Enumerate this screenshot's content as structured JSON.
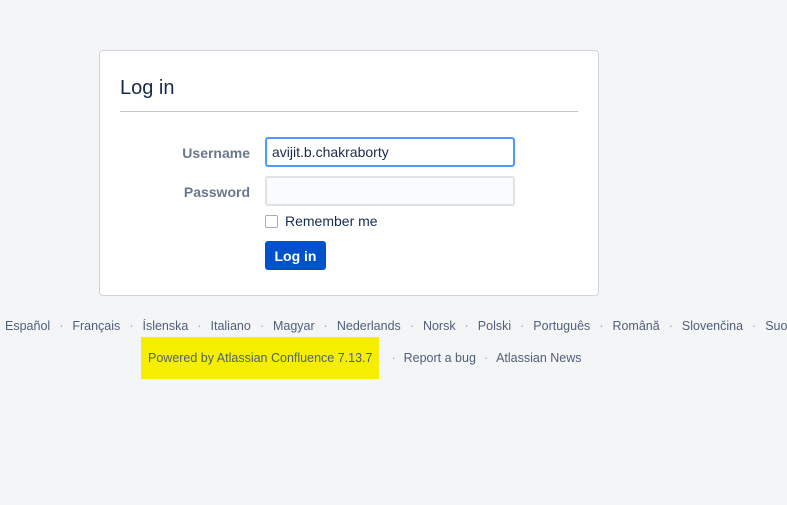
{
  "login": {
    "title": "Log in",
    "username_label": "Username",
    "username_value": "avijit.b.chakraborty",
    "password_label": "Password",
    "password_value": "",
    "remember_label": "Remember me",
    "remember_checked": false,
    "submit_label": "Log in"
  },
  "languages": [
    "Español",
    "Français",
    "Íslenska",
    "Italiano",
    "Magyar",
    "Nederlands",
    "Norsk",
    "Polski",
    "Português",
    "Română",
    "Slovenčina",
    "Suo"
  ],
  "footer": {
    "powered_by": "Powered by Atlassian Confluence 7.13.7",
    "report_bug": "Report a bug",
    "news": "Atlassian News"
  },
  "colors": {
    "primary_button": "#0052cc",
    "focus_border": "#4c9aff",
    "highlight": "#f5ee00",
    "background": "#f4f5f7"
  }
}
